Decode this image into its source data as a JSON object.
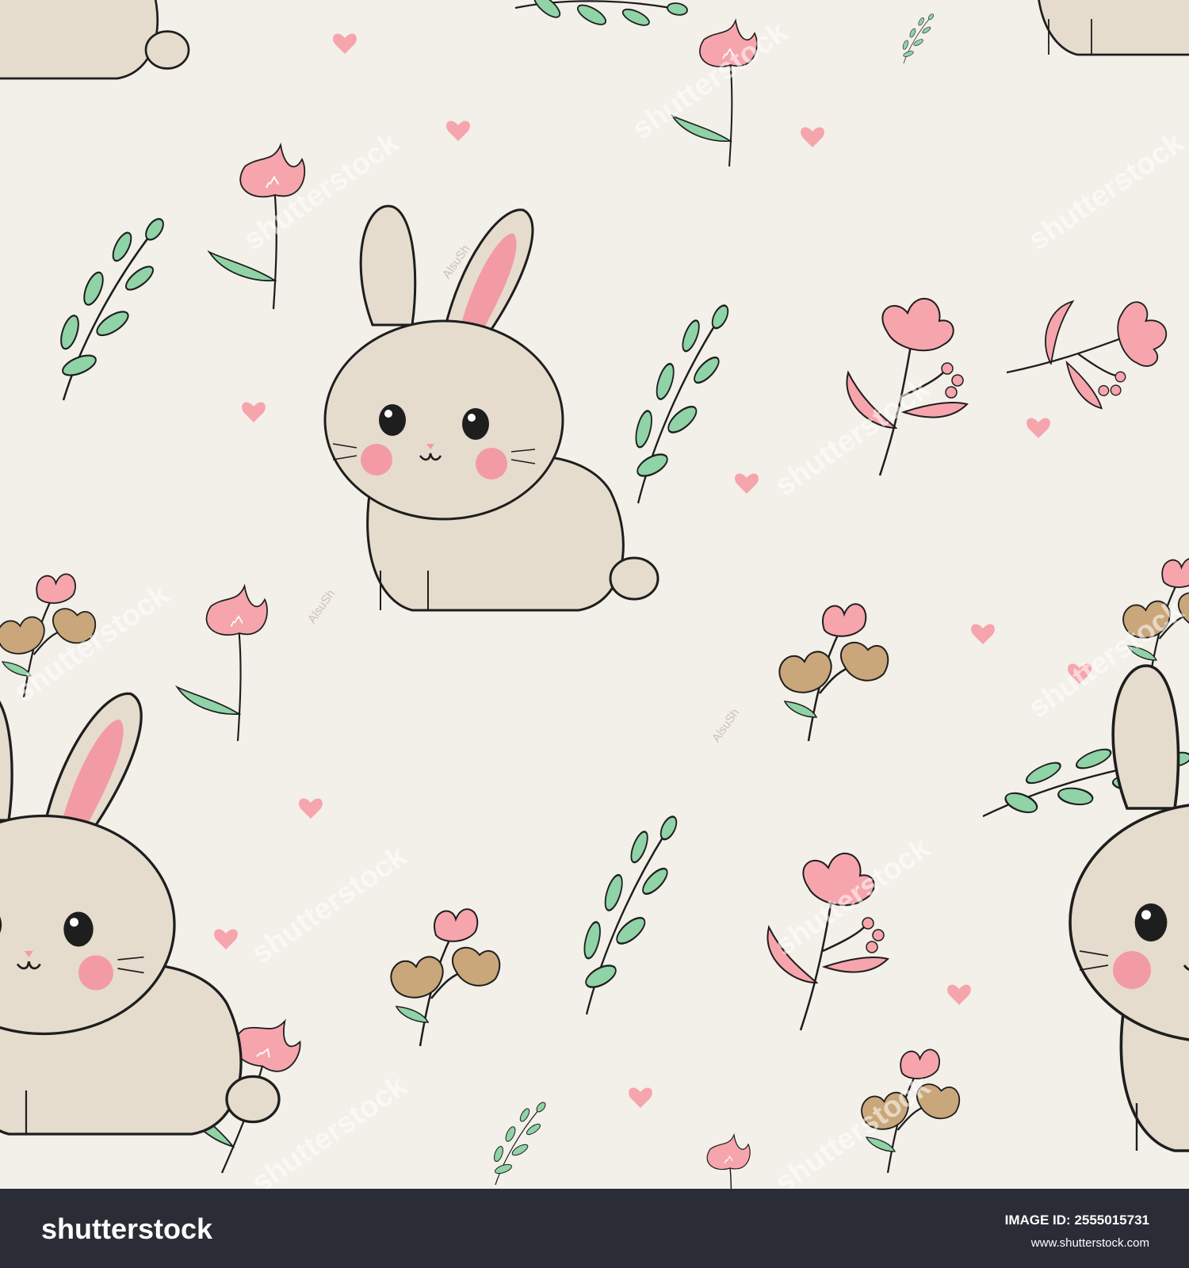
{
  "illustration": {
    "subject": "bunny-floral-pattern",
    "colors": {
      "background": "#f3efe9",
      "bunny": "#e5dccd",
      "bunny_shadow": "#d6cab5",
      "ear_inner": "#f39ba5",
      "flower_pink": "#f6a5ad",
      "flower_tan": "#c9a77a",
      "leaf": "#8fd3a6",
      "heart": "#f6a5ad",
      "outline": "#1e1e1e"
    }
  },
  "watermark": {
    "text": "shutterstock",
    "artist": "AlsuSh"
  },
  "footer": {
    "logo": "shutterstock",
    "image_id_label": "IMAGE ID: 2555015731",
    "site": "www.shutterstock.com"
  }
}
